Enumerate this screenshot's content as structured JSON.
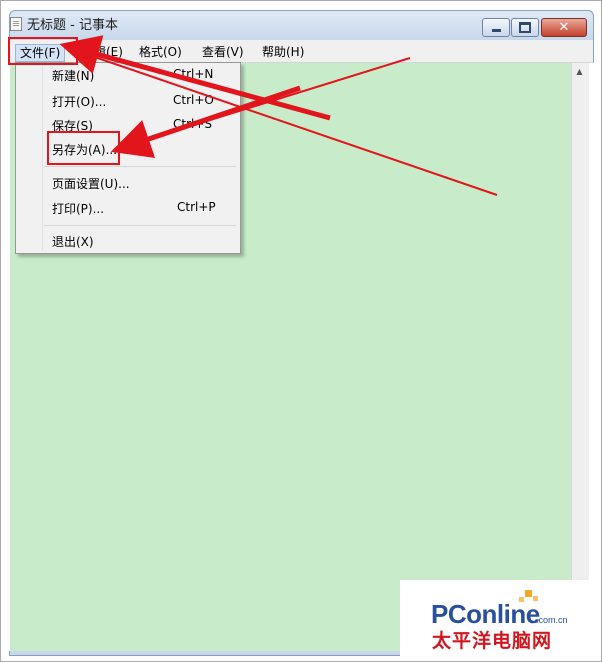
{
  "window": {
    "title": "无标题 - 记事本",
    "min_icon": "minimize-icon",
    "max_icon": "maximize-icon",
    "close_icon": "close-icon",
    "close_glyph": "✕"
  },
  "menubar": {
    "file": "文件(F)",
    "edit_partial": "编辑(E)",
    "format": "格式(O)",
    "view": "查看(V)",
    "help": "帮助(H)"
  },
  "file_menu": {
    "items": [
      {
        "label": "新建(N)",
        "shortcut": "Ctrl+N"
      },
      {
        "label": "打开(O)...",
        "shortcut": "Ctrl+O"
      },
      {
        "label": "保存(S)",
        "shortcut": "Ctrl+S"
      },
      {
        "label": "另存为(A)...",
        "shortcut": ""
      },
      {
        "label": "页面设置(U)...",
        "shortcut": ""
      },
      {
        "label": "打印(P)...",
        "shortcut": "Ctrl+P"
      },
      {
        "label": "退出(X)",
        "shortcut": ""
      }
    ]
  },
  "colors": {
    "editor_background": "#c8ecc9",
    "annotation": "#e2141c"
  },
  "watermark": {
    "logo": "PConline",
    "domain": ".com.cn",
    "chinese": "太平洋电脑网"
  }
}
